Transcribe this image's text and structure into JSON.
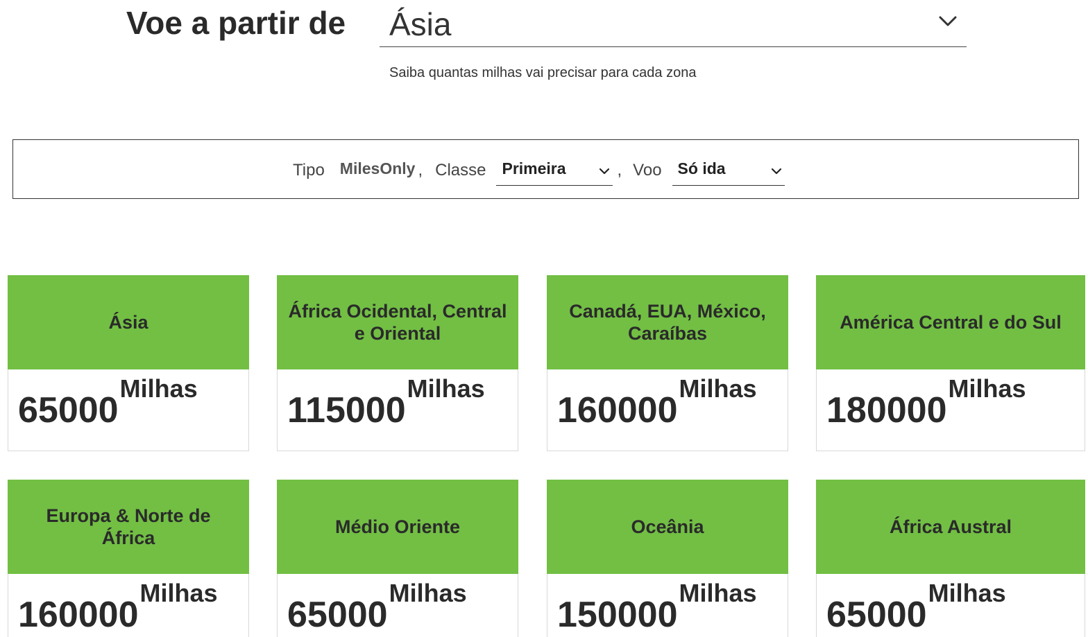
{
  "header": {
    "title": "Voe a partir de",
    "region_selected": "Ásia",
    "subtitle": "Saiba quantas milhas vai precisar para cada zona"
  },
  "filters": {
    "tipo_label": "Tipo",
    "tipo_value": "MilesOnly",
    "separator": ",",
    "classe_label": "Classe",
    "classe_value": "Primeira",
    "voo_label": "Voo",
    "voo_value": "Só ida"
  },
  "icons": {
    "dropdown": "chevron-down-icon"
  },
  "colors": {
    "card_header": "#72bf44",
    "text": "#2a2a2a"
  },
  "zones": [
    {
      "name": "Ásia",
      "miles": "65000",
      "unit": "Milhas"
    },
    {
      "name": "África Ocidental, Central e Oriental",
      "miles": "115000",
      "unit": "Milhas"
    },
    {
      "name": "Canadá, EUA, México, Caraíbas",
      "miles": "160000",
      "unit": "Milhas"
    },
    {
      "name": "América Central e do Sul",
      "miles": "180000",
      "unit": "Milhas"
    },
    {
      "name": "Europa & Norte de África",
      "miles": "160000",
      "unit": "Milhas"
    },
    {
      "name": "Médio Oriente",
      "miles": "65000",
      "unit": "Milhas"
    },
    {
      "name": "Oceânia",
      "miles": "150000",
      "unit": "Milhas"
    },
    {
      "name": "África Austral",
      "miles": "65000",
      "unit": "Milhas"
    }
  ]
}
